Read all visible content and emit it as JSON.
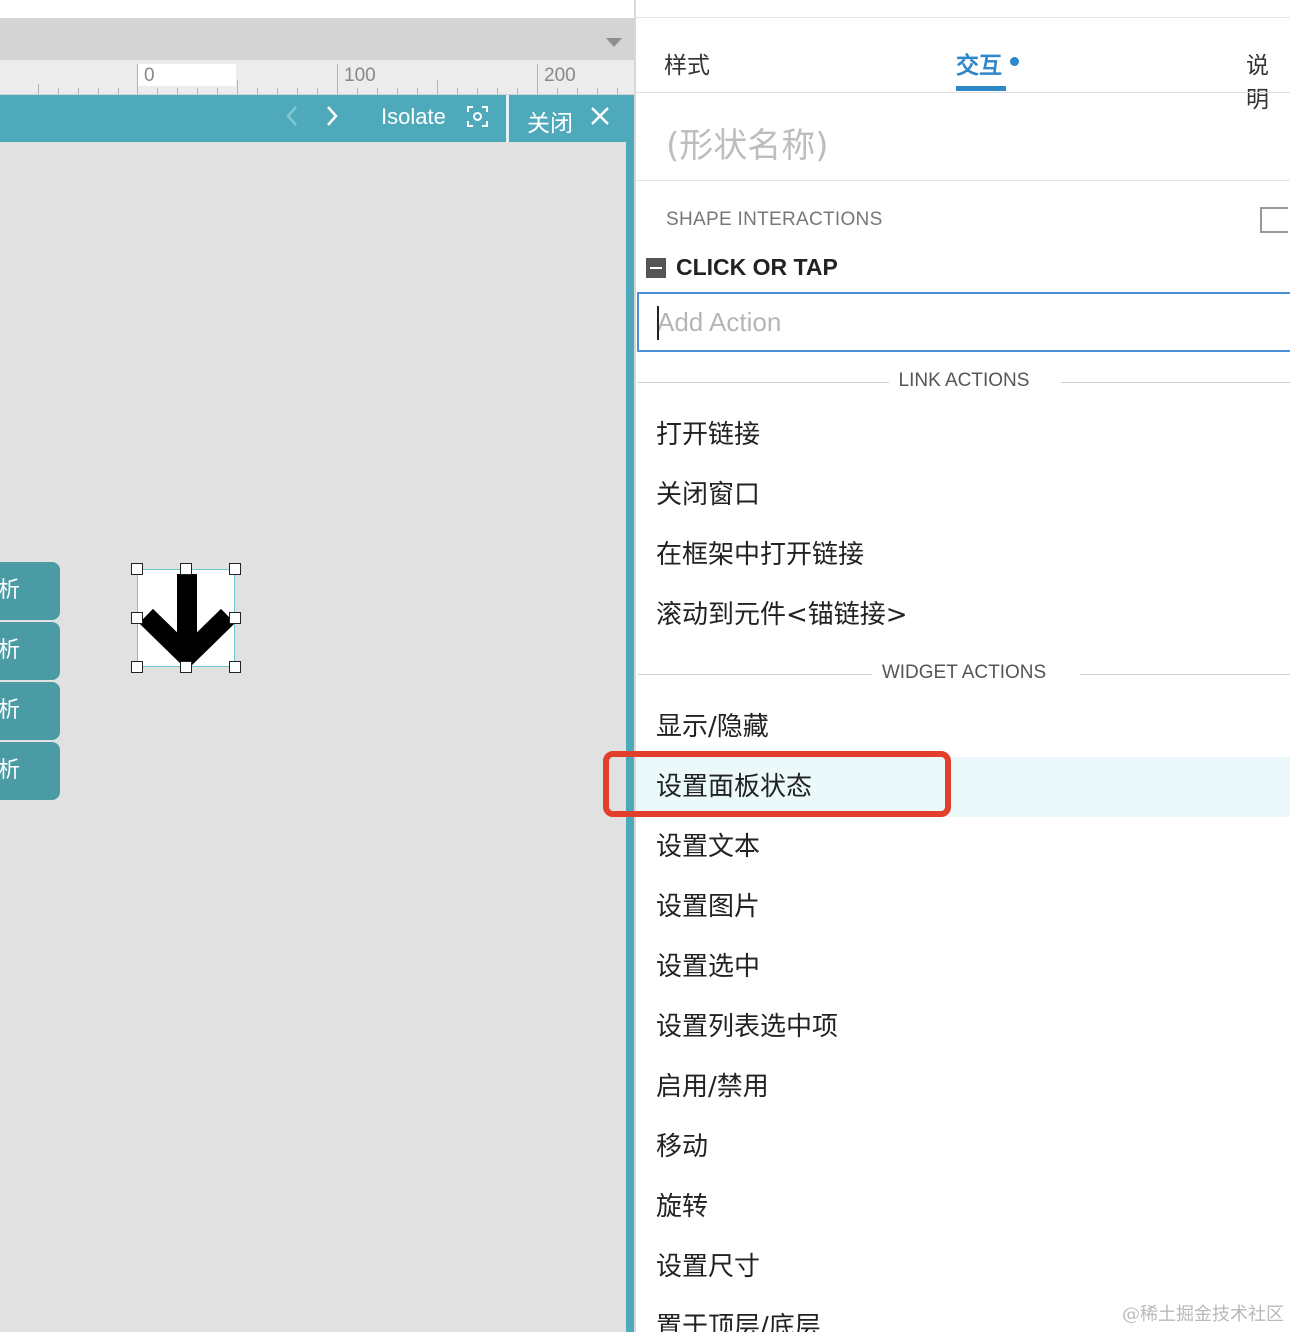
{
  "canvas": {
    "ruler": {
      "labels": [
        "0",
        "100",
        "200"
      ]
    },
    "toolbar": {
      "prev_icon": "chevron-left-icon",
      "next_icon": "chevron-right-icon",
      "isolate_label": "Isolate",
      "isolate_icon": "isolate-icon",
      "close_label": "关闭",
      "close_icon": "close-icon"
    },
    "side_tabs": [
      "析",
      "析",
      "析",
      "析"
    ],
    "shape": {
      "icon": "arrow-down-icon",
      "selected": true
    },
    "colors": {
      "accent": "#4eaaba",
      "side_tab": "#4a9ba3"
    }
  },
  "inspector": {
    "tabs": [
      {
        "label": "样式",
        "active": false
      },
      {
        "label": "交互",
        "active": true
      },
      {
        "label": "说明",
        "active": false
      }
    ],
    "shape_name_placeholder": "(形状名称)",
    "section_title": "SHAPE INTERACTIONS",
    "event_label": "CLICK OR TAP",
    "add_action_placeholder": "Add Action",
    "groups": [
      {
        "title": "LINK ACTIONS",
        "items": [
          "打开链接",
          "关闭窗口",
          "在框架中打开链接",
          "滚动到元件<锚链接>"
        ]
      },
      {
        "title": "WIDGET ACTIONS",
        "items": [
          "显示/隐藏",
          "设置面板状态",
          "设置文本",
          "设置图片",
          "设置选中",
          "设置列表选中项",
          "启用/禁用",
          "移动",
          "旋转",
          "设置尺寸",
          "置于顶层/底层"
        ]
      }
    ],
    "highlighted_item": "设置面板状态",
    "colors": {
      "active_tab": "#2d87c9",
      "highlight": "#e3402c",
      "hover_row": "#ebf9fa"
    }
  },
  "watermark": "@稀土掘金技术社区"
}
